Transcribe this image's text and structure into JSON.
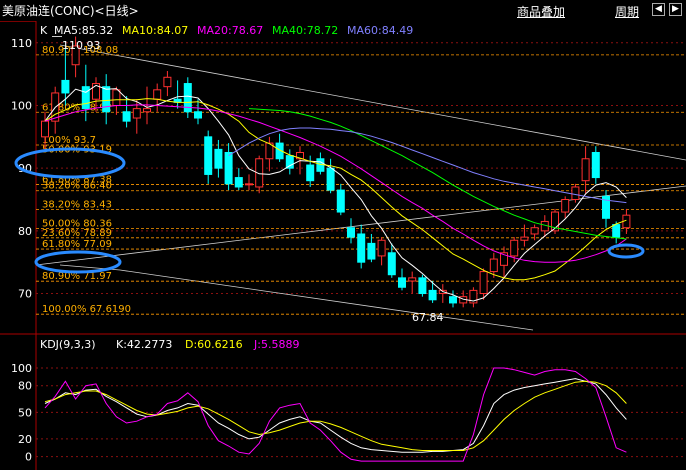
{
  "window": {
    "title": "美原油连(CONC)<日线>",
    "tabs": [
      "商品叠加",
      "周期"
    ],
    "buttons": [
      "◀",
      "▶"
    ]
  },
  "indicators": {
    "ma": [
      {
        "label": "K",
        "color": "#ffffff"
      },
      {
        "label": "MA5:85.32",
        "color": "#ffffff"
      },
      {
        "label": "MA10:84.07",
        "color": "#ffff00"
      },
      {
        "label": "MA20:78.67",
        "color": "#ff00ff"
      },
      {
        "label": "MA40:78.72",
        "color": "#00ff00"
      },
      {
        "label": "MA60:84.49",
        "color": "#8080ff"
      }
    ],
    "kdj": [
      {
        "label": "KDJ(9,3,3)",
        "color": "#ffffff"
      },
      {
        "label": "K:42.2773",
        "color": "#ffffff"
      },
      {
        "label": "D:60.6216",
        "color": "#ffff00"
      },
      {
        "label": "J:5.5889",
        "color": "#ff00ff"
      }
    ]
  },
  "annotations": {
    "high": "110.93",
    "low": "67.84",
    "fib_labels": [
      {
        "text": "80.90% 108.08",
        "y": 108.08
      },
      {
        "text": "61.80% 98.92",
        "y": 98.92
      },
      {
        "text": "100% 93.7",
        "y": 93.7
      },
      {
        "text": "50.00% 93.19",
        "y": 92.2
      },
      {
        "text": "61.80% 87.38",
        "y": 87.38
      },
      {
        "text": "38.20% 86.40",
        "y": 86.4
      },
      {
        "text": "38.20% 83.43",
        "y": 83.43
      },
      {
        "text": "50.00% 80.36",
        "y": 80.36
      },
      {
        "text": "23.60% 78.89",
        "y": 78.89
      },
      {
        "text": "61.80% 77.09",
        "y": 77.09
      },
      {
        "text": "80.90% 71.97",
        "y": 71.97
      },
      {
        "text": "100.00% 67.6190",
        "y": 66.7
      }
    ]
  },
  "chart_data": [
    {
      "type": "candlestick",
      "title": "美原油连(CONC)<日线>",
      "ylim": [
        64.5,
        113
      ],
      "y_ticks": [
        70,
        80,
        90,
        100,
        110
      ],
      "hlines": [
        108.08,
        98.92,
        93.7,
        87.38,
        86.4,
        83.43,
        80.36,
        78.89,
        77.09,
        71.97,
        66.7
      ],
      "candles": [
        [
          95.0,
          99.0,
          93.0,
          97.5
        ],
        [
          97.5,
          103.0,
          95.5,
          102.0
        ],
        [
          104.0,
          109.0,
          100.0,
          102.0
        ],
        [
          106.5,
          111.0,
          104.5,
          109.5
        ],
        [
          103.0,
          106.5,
          97.5,
          99.5
        ],
        [
          101.0,
          104.5,
          99.0,
          103.5
        ],
        [
          103.0,
          105.0,
          97.0,
          99.0
        ],
        [
          100.0,
          103.0,
          98.5,
          102.5
        ],
        [
          99.0,
          101.5,
          96.5,
          97.5
        ],
        [
          98.0,
          101.0,
          95.5,
          99.5
        ],
        [
          99.0,
          103.0,
          97.0,
          99.5
        ],
        [
          101.0,
          103.5,
          99.0,
          102.5
        ],
        [
          103.0,
          105.5,
          101.5,
          104.5
        ],
        [
          101.0,
          104.0,
          99.5,
          100.5
        ],
        [
          103.5,
          104.5,
          98.0,
          99.0
        ],
        [
          99.0,
          101.0,
          97.0,
          98.0
        ],
        [
          95.0,
          96.0,
          87.5,
          89.0
        ],
        [
          93.0,
          94.5,
          88.5,
          90.0
        ],
        [
          92.5,
          94.0,
          86.5,
          87.5
        ],
        [
          88.5,
          90.0,
          86.5,
          87.0
        ],
        [
          87.5,
          89.0,
          86.5,
          87.5
        ],
        [
          87.0,
          92.0,
          86.0,
          91.5
        ],
        [
          91.5,
          95.0,
          89.5,
          94.0
        ],
        [
          94.0,
          95.5,
          91.0,
          91.5
        ],
        [
          92.0,
          93.0,
          89.0,
          90.0
        ],
        [
          91.5,
          93.5,
          89.0,
          92.5
        ],
        [
          90.5,
          92.0,
          87.0,
          88.0
        ],
        [
          91.5,
          92.5,
          89.0,
          89.5
        ],
        [
          90.0,
          91.5,
          86.0,
          86.5
        ],
        [
          86.5,
          87.5,
          82.5,
          83.0
        ],
        [
          80.5,
          82.0,
          78.0,
          79.0
        ],
        [
          79.5,
          81.0,
          74.0,
          75.0
        ],
        [
          78.0,
          79.5,
          75.0,
          75.5
        ],
        [
          76.0,
          79.0,
          74.5,
          78.5
        ],
        [
          76.5,
          78.0,
          72.5,
          73.0
        ],
        [
          72.5,
          74.0,
          70.5,
          71.0
        ],
        [
          72.0,
          73.5,
          70.0,
          72.5
        ],
        [
          72.5,
          73.0,
          69.5,
          70.0
        ],
        [
          70.5,
          72.0,
          68.5,
          69.0
        ],
        [
          70.0,
          71.5,
          68.5,
          70.5
        ],
        [
          69.5,
          70.5,
          67.8,
          68.5
        ],
        [
          68.5,
          70.5,
          67.8,
          69.5
        ],
        [
          68.5,
          71.0,
          67.8,
          70.5
        ],
        [
          70.0,
          74.0,
          69.0,
          73.5
        ],
        [
          73.5,
          76.5,
          72.5,
          75.5
        ],
        [
          74.5,
          77.5,
          72.5,
          76.5
        ],
        [
          76.0,
          79.0,
          75.0,
          78.5
        ],
        [
          78.5,
          81.0,
          77.5,
          79.0
        ],
        [
          79.5,
          81.0,
          78.5,
          80.5
        ],
        [
          80.0,
          82.5,
          79.0,
          81.5
        ],
        [
          80.0,
          83.5,
          79.5,
          83.0
        ],
        [
          83.0,
          85.5,
          82.0,
          85.0
        ],
        [
          85.0,
          87.5,
          84.5,
          87.0
        ],
        [
          88.0,
          93.5,
          86.0,
          91.5
        ],
        [
          92.5,
          93.5,
          87.5,
          88.5
        ],
        [
          85.5,
          86.5,
          80.5,
          82.0
        ],
        [
          81.0,
          81.5,
          78.0,
          79.0
        ],
        [
          80.5,
          83.5,
          79.5,
          82.5
        ]
      ],
      "series": [
        {
          "name": "MA5",
          "color": "#ffffff",
          "values": [
            97.5,
            99.7,
            101.0,
            102.6,
            102.1,
            103.2,
            102.6,
            102.7,
            101.1,
            100.6,
            99.7,
            100.1,
            100.8,
            101.4,
            101.5,
            101.2,
            99.5,
            97.5,
            95.3,
            92.0,
            89.9,
            89.1,
            89.0,
            89.4,
            90.4,
            91.2,
            91.1,
            91.0,
            90.1,
            88.9,
            86.9,
            85.0,
            82.4,
            80.4,
            77.8,
            75.7,
            74.5,
            73.2,
            71.7,
            70.3,
            69.8,
            69.1,
            68.8,
            69.3,
            70.8,
            72.5,
            74.5,
            76.4,
            77.8,
            79.2,
            80.4,
            81.9,
            83.7,
            85.9,
            87.3,
            87.7,
            87.0,
            85.3
          ]
        },
        {
          "name": "MA10",
          "color": "#ffff00",
          "values": [
            97.5,
            98.6,
            99.3,
            100.1,
            100.3,
            100.7,
            100.8,
            100.9,
            100.9,
            100.9,
            101.1,
            101.0,
            100.7,
            100.5,
            100.5,
            100.6,
            100.1,
            99.4,
            98.6,
            97.5,
            95.7,
            94.6,
            93.9,
            92.9,
            92.1,
            91.6,
            91.1,
            90.6,
            90.4,
            90.0,
            89.0,
            88.1,
            86.8,
            85.3,
            83.8,
            82.4,
            81.3,
            80.2,
            78.9,
            77.6,
            76.3,
            75.5,
            74.6,
            73.7,
            73.0,
            72.5,
            72.2,
            72.2,
            72.5,
            73.0,
            73.6,
            74.8,
            76.1,
            77.5,
            79.0,
            80.2,
            81.1,
            81.7
          ]
        },
        {
          "name": "MA20",
          "color": "#ff00ff",
          "values": [
            97.5,
            98.0,
            98.5,
            99.0,
            99.3,
            99.6,
            99.8,
            100.0,
            100.0,
            100.1,
            100.1,
            100.0,
            99.9,
            99.8,
            99.7,
            99.6,
            99.4,
            99.1,
            98.7,
            98.3,
            97.8,
            97.3,
            96.7,
            96.1,
            95.5,
            94.9,
            94.2,
            93.5,
            92.7,
            91.9,
            90.9,
            89.9,
            88.8,
            87.7,
            86.6,
            85.5,
            84.5,
            83.6,
            82.5,
            81.5,
            80.4,
            79.5,
            78.5,
            77.6,
            76.8,
            76.2,
            75.7,
            75.3,
            75.1,
            75.0,
            75.0,
            75.1,
            75.3,
            75.7,
            76.2,
            76.8,
            77.6,
            78.7
          ]
        },
        {
          "name": "MA40",
          "color": "#00ff00",
          "values": [
            null,
            null,
            null,
            null,
            null,
            null,
            null,
            null,
            null,
            null,
            null,
            null,
            null,
            null,
            null,
            null,
            null,
            null,
            null,
            null,
            99.5,
            99.4,
            99.3,
            99.2,
            99.0,
            98.7,
            98.3,
            97.8,
            97.3,
            96.7,
            96.0,
            95.2,
            94.4,
            93.6,
            92.8,
            92.0,
            91.1,
            90.2,
            89.3,
            88.3,
            87.3,
            86.4,
            85.5,
            84.7,
            83.9,
            83.2,
            82.5,
            81.9,
            81.3,
            80.9,
            80.5,
            80.2,
            79.9,
            79.6,
            79.3,
            79.1,
            78.9,
            78.7
          ]
        },
        {
          "name": "MA60",
          "color": "#8080ff",
          "values": [
            null,
            null,
            null,
            null,
            null,
            null,
            null,
            null,
            null,
            null,
            null,
            null,
            null,
            null,
            null,
            null,
            null,
            null,
            92.0,
            93.0,
            94.0,
            94.8,
            95.5,
            96.0,
            96.3,
            96.4,
            96.4,
            96.3,
            96.2,
            96.0,
            95.8,
            95.5,
            95.1,
            94.6,
            94.1,
            93.5,
            92.9,
            92.3,
            91.7,
            91.1,
            90.5,
            89.9,
            89.3,
            88.8,
            88.3,
            87.9,
            87.6,
            87.3,
            87.0,
            86.7,
            86.4,
            86.1,
            85.8,
            85.5,
            85.2,
            84.9,
            84.7,
            84.5
          ]
        }
      ]
    },
    {
      "type": "line",
      "title": "KDJ(9,3,3)",
      "ylim": [
        -6,
        118
      ],
      "y_ticks": [
        100,
        80,
        50,
        20,
        0
      ],
      "hlines": [
        100,
        80,
        50,
        20,
        0
      ],
      "series": [
        {
          "name": "K",
          "color": "#ffffff",
          "values": [
            60,
            65,
            72,
            70,
            75,
            76,
            68,
            62,
            55,
            48,
            45,
            47,
            52,
            55,
            60,
            58,
            48,
            38,
            32,
            25,
            20,
            22,
            30,
            38,
            42,
            45,
            40,
            38,
            30,
            22,
            15,
            10,
            8,
            7,
            6,
            5,
            5,
            5,
            6,
            6,
            7,
            8,
            15,
            35,
            60,
            70,
            75,
            78,
            80,
            82,
            84,
            86,
            88,
            85,
            82,
            70,
            55,
            42
          ]
        },
        {
          "name": "D",
          "color": "#ffff00",
          "values": [
            62,
            65,
            70,
            72,
            74,
            74,
            70,
            64,
            58,
            52,
            48,
            47,
            49,
            51,
            55,
            57,
            54,
            48,
            42,
            35,
            28,
            25,
            27,
            30,
            34,
            38,
            40,
            40,
            37,
            33,
            28,
            23,
            18,
            14,
            12,
            10,
            8,
            7,
            7,
            7,
            7,
            7,
            10,
            18,
            30,
            42,
            52,
            60,
            67,
            72,
            76,
            80,
            84,
            85,
            84,
            80,
            72,
            60
          ]
        },
        {
          "name": "J",
          "color": "#ff00ff",
          "values": [
            55,
            68,
            85,
            65,
            80,
            82,
            60,
            45,
            38,
            40,
            45,
            48,
            60,
            63,
            72,
            62,
            35,
            18,
            12,
            5,
            3,
            15,
            40,
            55,
            58,
            60,
            38,
            30,
            18,
            5,
            -3,
            -5,
            -5,
            -5,
            -5,
            -5,
            -5,
            -5,
            -5,
            -5,
            -5,
            -5,
            25,
            70,
            100,
            100,
            98,
            95,
            92,
            96,
            98,
            98,
            96,
            88,
            78,
            45,
            10,
            5
          ]
        }
      ]
    }
  ]
}
